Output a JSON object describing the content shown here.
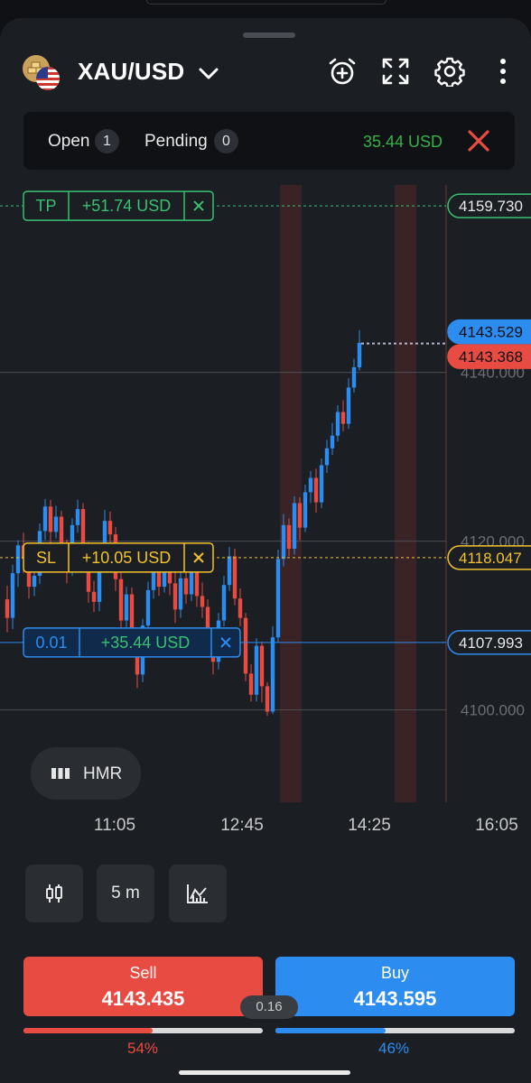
{
  "header": {
    "symbol": "XAU/USD",
    "icons": [
      "gold-bars-flag-icon",
      "us-flag-icon",
      "chevron-down-icon",
      "alarm-add-icon",
      "fullscreen-icon",
      "gear-icon",
      "more-vertical-icon"
    ]
  },
  "status": {
    "open_label": "Open",
    "open_count": "1",
    "pending_label": "Pending",
    "pending_count": "0",
    "pnl": "35.44 USD",
    "pnl_color": "#36b24a",
    "close_color": "#e84b42"
  },
  "chart": {
    "price_min": 4097.5,
    "price_max": 4162.2,
    "grid_prices": [
      {
        "price": 4140,
        "label": "4140.000"
      },
      {
        "price": 4120,
        "label": "4120.000"
      },
      {
        "price": 4100,
        "label": "4100.000"
      }
    ],
    "time_labels": [
      "11:05",
      "12:45",
      "14:25",
      "16:05"
    ],
    "ask": {
      "value": 4143.529,
      "label": "4143.529",
      "color": "#2d8cf0"
    },
    "bid": {
      "value": 4143.368,
      "label": "4143.368",
      "color": "#e84b42"
    },
    "tp": {
      "tag": "TP",
      "amount": "+51.74 USD",
      "price": 4159.73,
      "price_label": "4159.730",
      "color": "#38c172"
    },
    "sl": {
      "tag": "SL",
      "amount": "+10.05 USD",
      "price": 4118.047,
      "price_label": "4118.047",
      "color": "#f2c12e"
    },
    "position": {
      "tag": "0.01",
      "amount": "+35.44 USD",
      "price": 4107.993,
      "price_label": "4107.993",
      "color": "#2d8cf0"
    },
    "hmr_label": "HMR",
    "up_color": "#2d8cf0",
    "down_color": "#e84b42"
  },
  "chart_data": {
    "type": "candlestick",
    "x": [
      "11:05",
      "12:45",
      "14:25",
      "16:05"
    ],
    "ylim": [
      4097.5,
      4162.2
    ],
    "series": [
      {
        "values": [
          [
            4113.1,
            4110.9,
            4114.7,
            4109.2
          ],
          [
            4110.9,
            4116.2,
            4117.2,
            4109.6
          ],
          [
            4116.2,
            4119.5,
            4120.1,
            4114.6
          ],
          [
            4119.5,
            4117.9,
            4121.0,
            4116.2
          ],
          [
            4117.9,
            4114.6,
            4119.2,
            4113.2
          ],
          [
            4114.6,
            4115.9,
            4117.4,
            4113.5
          ],
          [
            4115.9,
            4121.2,
            4122.1,
            4114.9
          ],
          [
            4121.2,
            4124.1,
            4125.0,
            4120.1
          ],
          [
            4124.1,
            4121.1,
            4124.9,
            4119.5
          ],
          [
            4121.1,
            4122.9,
            4124.2,
            4120.3
          ],
          [
            4122.9,
            4118.4,
            4123.6,
            4116.4
          ],
          [
            4118.4,
            4116.9,
            4120.2,
            4115.0
          ],
          [
            4116.9,
            4121.9,
            4122.7,
            4115.9
          ],
          [
            4121.9,
            4123.8,
            4124.9,
            4121.0
          ],
          [
            4123.8,
            4118.7,
            4124.5,
            4117.5
          ],
          [
            4118.7,
            4114.0,
            4119.9,
            4112.7
          ],
          [
            4114.0,
            4112.8,
            4115.3,
            4111.6
          ],
          [
            4112.8,
            4117.0,
            4118.7,
            4111.7
          ],
          [
            4117.0,
            4122.4,
            4123.7,
            4116.3
          ],
          [
            4122.4,
            4120.8,
            4123.5,
            4119.5
          ],
          [
            4120.8,
            4115.5,
            4121.7,
            4114.1
          ],
          [
            4115.5,
            4110.6,
            4116.6,
            4109.3
          ],
          [
            4110.6,
            4113.7,
            4114.6,
            4109.8
          ],
          [
            4113.7,
            4108.7,
            4114.5,
            4107.5
          ],
          [
            4108.7,
            4104.2,
            4109.6,
            4102.6
          ],
          [
            4104.2,
            4110.0,
            4110.8,
            4103.3
          ],
          [
            4110.0,
            4114.2,
            4115.2,
            4109.3
          ],
          [
            4114.2,
            4117.1,
            4118.4,
            4113.2
          ],
          [
            4117.1,
            4114.6,
            4118.2,
            4113.5
          ],
          [
            4114.6,
            4118.7,
            4119.6,
            4113.9
          ],
          [
            4118.7,
            4115.0,
            4119.5,
            4113.6
          ],
          [
            4115.0,
            4111.9,
            4116.3,
            4110.3
          ],
          [
            4111.9,
            4115.6,
            4116.8,
            4110.9
          ],
          [
            4115.6,
            4113.7,
            4116.4,
            4112.6
          ],
          [
            4113.7,
            4116.9,
            4117.9,
            4112.9
          ],
          [
            4116.9,
            4113.5,
            4117.6,
            4112.2
          ],
          [
            4113.5,
            4112.2,
            4115.1,
            4110.9
          ],
          [
            4112.2,
            4108.3,
            4113.1,
            4106.7
          ],
          [
            4108.3,
            4105.7,
            4109.4,
            4104.2
          ],
          [
            4105.7,
            4110.6,
            4111.5,
            4104.8
          ],
          [
            4110.6,
            4114.8,
            4115.9,
            4109.9
          ],
          [
            4114.8,
            4118.2,
            4119.3,
            4114.1
          ],
          [
            4118.2,
            4113.2,
            4119.1,
            4112.4
          ],
          [
            4113.2,
            4110.9,
            4114.4,
            4109.9
          ],
          [
            4110.9,
            4104.3,
            4111.5,
            4103.4
          ],
          [
            4104.3,
            4101.8,
            4105.4,
            4101.0
          ],
          [
            4101.8,
            4107.6,
            4108.5,
            4101.0
          ],
          [
            4107.6,
            4102.8,
            4108.1,
            4100.9
          ],
          [
            4102.8,
            4099.8,
            4103.3,
            4099.3
          ],
          [
            4099.8,
            4108.6,
            4109.9,
            4099.5
          ],
          [
            4108.6,
            4117.9,
            4119.0,
            4108.0
          ],
          [
            4117.9,
            4121.9,
            4123.2,
            4117.0
          ],
          [
            4121.9,
            4119.1,
            4122.7,
            4118.2
          ],
          [
            4119.1,
            4124.5,
            4125.3,
            4118.4
          ],
          [
            4124.5,
            4121.6,
            4125.2,
            4120.1
          ],
          [
            4121.6,
            4125.8,
            4126.7,
            4121.1
          ],
          [
            4125.8,
            4127.5,
            4128.3,
            4124.5
          ],
          [
            4127.5,
            4124.6,
            4128.6,
            4123.4
          ],
          [
            4124.6,
            4129.0,
            4129.8,
            4123.9
          ],
          [
            4129.0,
            4131.0,
            4132.0,
            4128.1
          ],
          [
            4131.0,
            4132.5,
            4134.0,
            4130.2
          ],
          [
            4132.5,
            4135.3,
            4136.1,
            4131.8
          ],
          [
            4135.3,
            4133.9,
            4136.7,
            4133.0
          ],
          [
            4133.9,
            4138.2,
            4139.3,
            4133.3
          ],
          [
            4138.2,
            4140.6,
            4141.6,
            4137.6
          ],
          [
            4140.6,
            4143.5,
            4145.0,
            4140.2
          ]
        ]
      }
    ]
  },
  "toolbar": {
    "chart_type_icon": "candlestick-icon",
    "timeframe_label": "5 m",
    "indicators_icon": "indicators-icon"
  },
  "trade": {
    "sell_label": "Sell",
    "sell_price": "4143.435",
    "buy_label": "Buy",
    "buy_price": "4143.595",
    "spread": "0.16",
    "sell_pct": "54%",
    "buy_pct": "46%",
    "sell_ratio": 0.54,
    "buy_ratio": 0.46,
    "sell_color": "#e84b42",
    "buy_color": "#2d8cf0"
  }
}
